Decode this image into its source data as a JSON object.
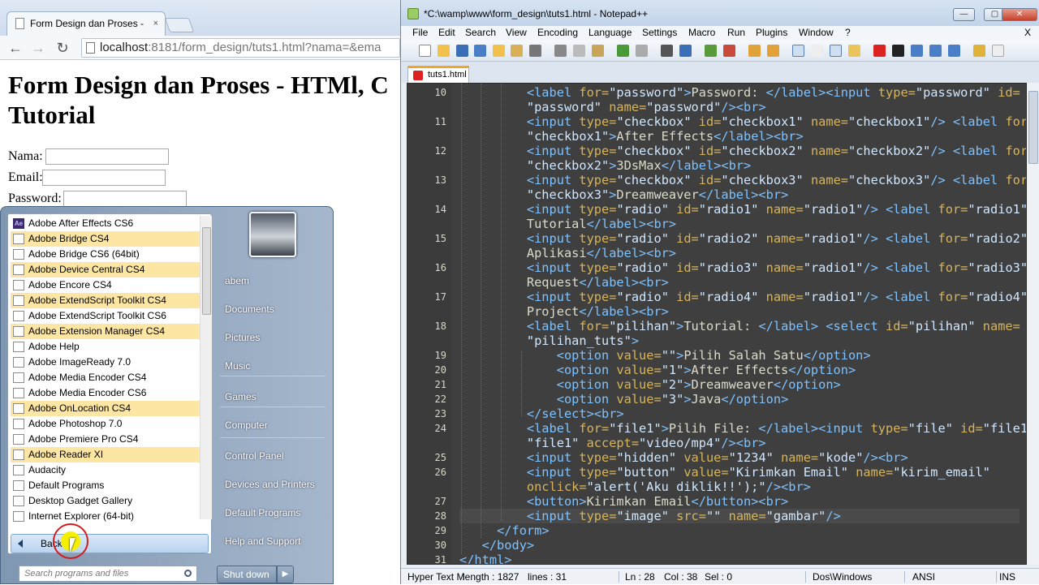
{
  "browser": {
    "tab_title": "Form Design dan Proses -",
    "tab_close": "×",
    "url_host": "localhost",
    "url_rest": ":8181/form_design/tuts1.html?nama=&ema",
    "page_title_line1": "Form Design dan Proses - HTMl, C",
    "page_title_line2": "Tutorial",
    "labels": {
      "nama": "Nama:",
      "email": "Email:",
      "password": "Password:"
    }
  },
  "start_menu": {
    "programs": [
      {
        "label": "Adobe After Effects CS6",
        "highlight": false,
        "icon": "ae-icon"
      },
      {
        "label": "Adobe Bridge CS4",
        "highlight": true,
        "icon": "app-icon"
      },
      {
        "label": "Adobe Bridge CS6 (64bit)",
        "highlight": false,
        "icon": "app-icon"
      },
      {
        "label": "Adobe Device Central CS4",
        "highlight": true,
        "icon": "app-icon"
      },
      {
        "label": "Adobe Encore CS4",
        "highlight": false,
        "icon": "app-icon"
      },
      {
        "label": "Adobe ExtendScript Toolkit CS4",
        "highlight": true,
        "icon": "app-icon"
      },
      {
        "label": "Adobe ExtendScript Toolkit CS6",
        "highlight": false,
        "icon": "app-icon"
      },
      {
        "label": "Adobe Extension Manager CS4",
        "highlight": true,
        "icon": "app-icon"
      },
      {
        "label": "Adobe Help",
        "highlight": false,
        "icon": "app-icon"
      },
      {
        "label": "Adobe ImageReady 7.0",
        "highlight": false,
        "icon": "app-icon"
      },
      {
        "label": "Adobe Media Encoder CS4",
        "highlight": false,
        "icon": "app-icon"
      },
      {
        "label": "Adobe Media Encoder CS6",
        "highlight": false,
        "icon": "app-icon"
      },
      {
        "label": "Adobe OnLocation CS4",
        "highlight": true,
        "icon": "app-icon"
      },
      {
        "label": "Adobe Photoshop 7.0",
        "highlight": false,
        "icon": "app-icon"
      },
      {
        "label": "Adobe Premiere Pro CS4",
        "highlight": false,
        "icon": "app-icon"
      },
      {
        "label": "Adobe Reader XI",
        "highlight": true,
        "icon": "app-icon"
      },
      {
        "label": "Audacity",
        "highlight": false,
        "icon": "app-icon"
      },
      {
        "label": "Default Programs",
        "highlight": false,
        "icon": "app-icon"
      },
      {
        "label": "Desktop Gadget Gallery",
        "highlight": false,
        "icon": "app-icon"
      },
      {
        "label": "Internet Explorer (64-bit)",
        "highlight": false,
        "icon": "app-icon"
      }
    ],
    "back_label": "Back",
    "search_placeholder": "Search programs and files",
    "right_links": [
      "abem",
      "Documents",
      "Pictures",
      "Music",
      "Games",
      "Computer",
      "Control Panel",
      "Devices and Printers",
      "Default Programs",
      "Help and Support"
    ],
    "shutdown_label": "Shut down",
    "shutdown_arrow": "▶"
  },
  "notepad": {
    "title": "*C:\\wamp\\www\\form_design\\tuts1.html - Notepad++",
    "window_buttons": [
      "—",
      "▢",
      "✕"
    ],
    "menu": [
      "File",
      "Edit",
      "Search",
      "View",
      "Encoding",
      "Language",
      "Settings",
      "Macro",
      "Run",
      "Plugins",
      "Window",
      "?"
    ],
    "menu_close": "X",
    "tab_label": "tuts1.html",
    "line_numbers": [
      "10",
      "11",
      "12",
      "13",
      "14",
      "15",
      "16",
      "17",
      "18",
      "19",
      "20",
      "21",
      "22",
      "23",
      "24",
      "25",
      "26",
      "27",
      "28",
      "29",
      "30",
      "31"
    ],
    "status": {
      "type": "Hyper Text M",
      "length": "length : 1827",
      "lines": "lines : 31",
      "ln": "Ln : 28",
      "col": "Col : 38",
      "sel": "Sel : 0",
      "eol": "Dos\\Windows",
      "enc": "ANSI",
      "mode": "INS"
    }
  }
}
